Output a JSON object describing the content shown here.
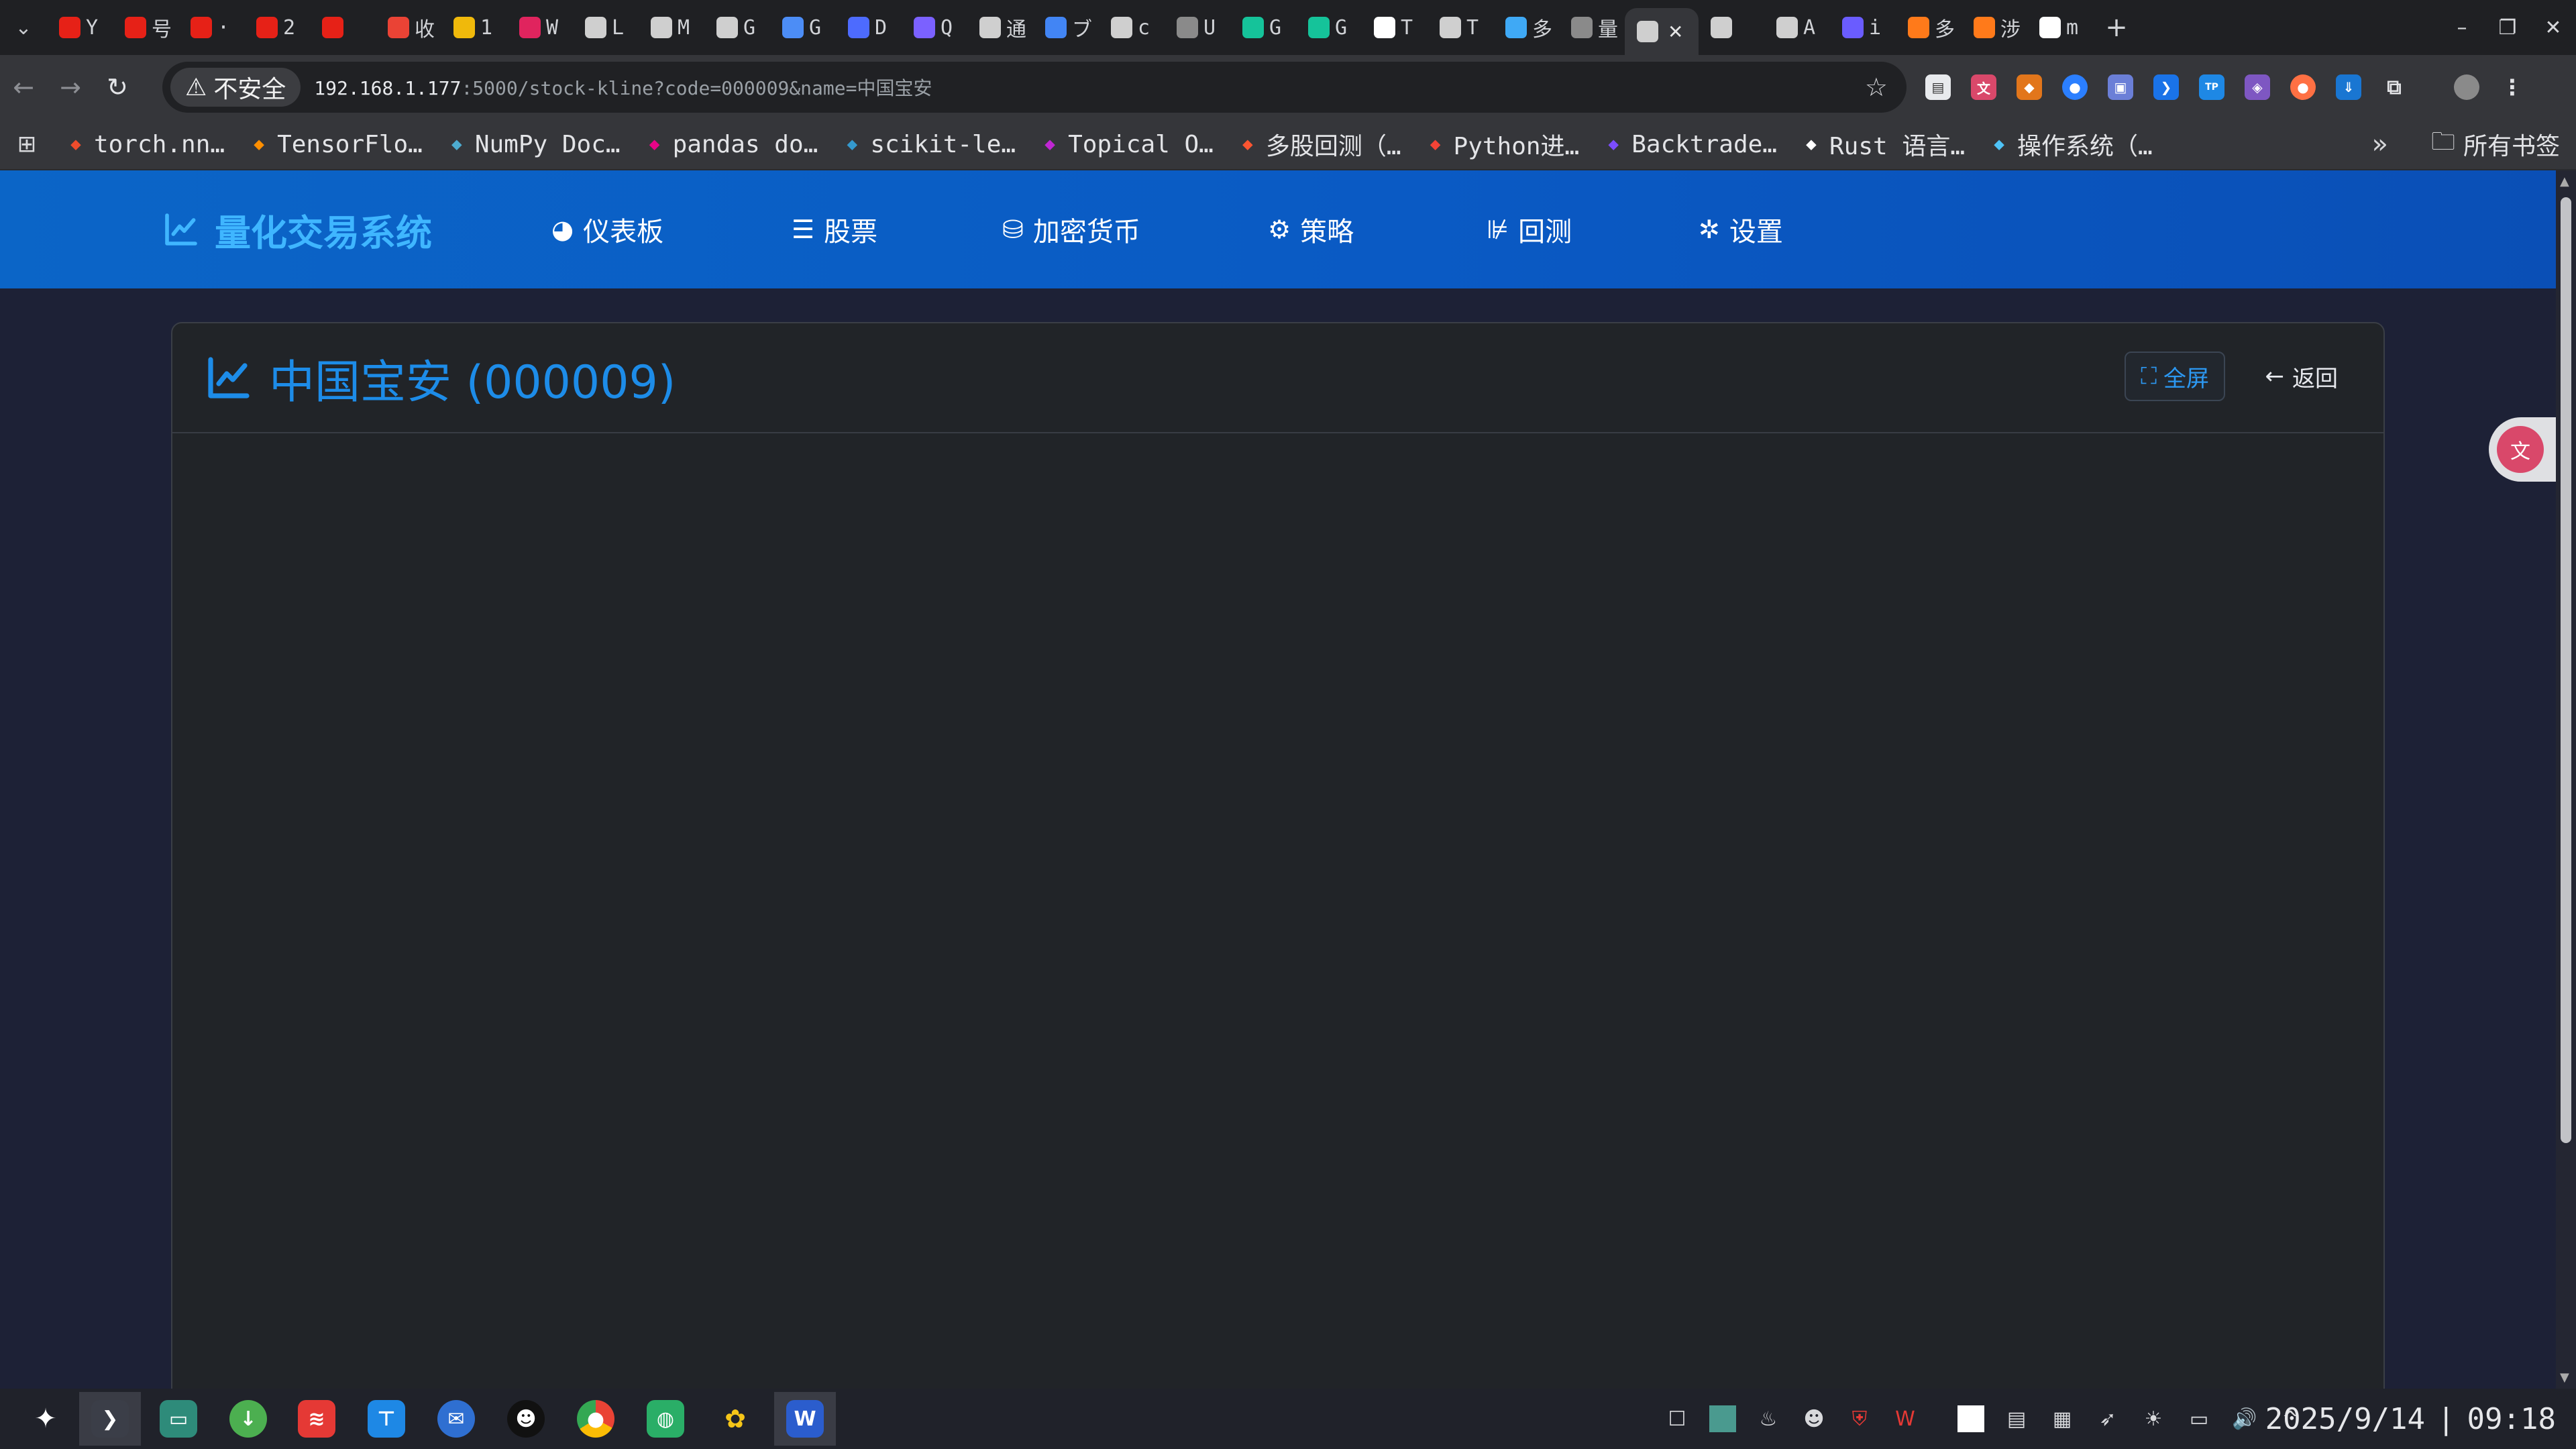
{
  "browser": {
    "tabs": [
      {
        "icon": "youtube-icon",
        "letter": "Y",
        "color": "#e62117"
      },
      {
        "icon": "youtube-icon",
        "letter": "号",
        "color": "#e62117"
      },
      {
        "icon": "youtube-icon",
        "letter": "·",
        "color": "#e62117"
      },
      {
        "icon": "youtube-icon",
        "letter": "2",
        "color": "#e62117"
      },
      {
        "icon": "youtube-icon",
        "letter": "",
        "color": "#e62117"
      },
      {
        "icon": "gmail-icon",
        "letter": "收",
        "color": "#ea4335"
      },
      {
        "icon": "binance-icon",
        "letter": "1",
        "color": "#f0b90b"
      },
      {
        "icon": "graph-icon",
        "letter": "W",
        "color": "#e0245e"
      },
      {
        "icon": "openai-icon",
        "letter": "L",
        "color": "#cfcfcf"
      },
      {
        "icon": "slash-icon",
        "letter": "M",
        "color": "#cfcfcf"
      },
      {
        "icon": "app-icon",
        "letter": "G",
        "color": "#cfcfcf"
      },
      {
        "icon": "gemini-icon",
        "letter": "G",
        "color": "#4c8df6"
      },
      {
        "icon": "deepseek-icon",
        "letter": "D",
        "color": "#4d6bfe"
      },
      {
        "icon": "qwen-icon",
        "letter": "Q",
        "color": "#7b61ff"
      },
      {
        "icon": "grid-icon",
        "letter": "通",
        "color": "#cfcfcf"
      },
      {
        "icon": "doc-icon",
        "letter": "ブ",
        "color": "#4285f4"
      },
      {
        "icon": "terminal-icon",
        "letter": "c",
        "color": "#cfcfcf"
      },
      {
        "icon": "globe-icon",
        "letter": "U",
        "color": "#8a8a8a"
      },
      {
        "icon": "grammarly-icon",
        "letter": "G",
        "color": "#15c39a"
      },
      {
        "icon": "grammarly-icon",
        "letter": "G",
        "color": "#15c39a"
      },
      {
        "icon": "github-icon",
        "letter": "T",
        "color": "#ffffff"
      },
      {
        "icon": "openai-icon",
        "letter": "T",
        "color": "#cfcfcf"
      },
      {
        "icon": "flutter-icon",
        "letter": "多",
        "color": "#3fa9f5"
      },
      {
        "icon": "globe-icon",
        "letter": "量",
        "color": "#8a8a8a"
      },
      {
        "icon": "page-icon",
        "letter": "",
        "color": "#cfcfcf"
      },
      {
        "icon": "book-icon",
        "letter": "A",
        "color": "#cfcfcf"
      },
      {
        "icon": "ai-icon",
        "letter": "i",
        "color": "#6a5cff"
      },
      {
        "icon": "feather-icon",
        "letter": "多",
        "color": "#ff7a1a"
      },
      {
        "icon": "feather-icon",
        "letter": "涉",
        "color": "#ff7a1a"
      },
      {
        "icon": "github-icon",
        "letter": "m",
        "color": "#ffffff"
      }
    ],
    "insecure_label": "不安全",
    "url_host": "192.168.1.177",
    "url_rest": ":5000/stock-kline?code=000009&name=中国宝安",
    "bookmarks": [
      {
        "icon": "pytorch-icon",
        "label": "torch.nn…",
        "color": "#ee4c2c"
      },
      {
        "icon": "tensorflow-icon",
        "label": "TensorFlo…",
        "color": "#ff8f00"
      },
      {
        "icon": "numpy-icon",
        "label": "NumPy Doc…",
        "color": "#4dabcf"
      },
      {
        "icon": "pandas-icon",
        "label": "pandas do…",
        "color": "#e70488"
      },
      {
        "icon": "sklearn-icon",
        "label": "scikit-le…",
        "color": "#3499cd"
      },
      {
        "icon": "topical-icon",
        "label": "Topical O…",
        "color": "#c026d3"
      },
      {
        "icon": "c-icon",
        "label": "多股回测（…",
        "color": "#fc5531"
      },
      {
        "icon": "fire-icon",
        "label": "Python进…",
        "color": "#f44336"
      },
      {
        "icon": "backtrader-icon",
        "label": "Backtrade…",
        "color": "#7c4dff"
      },
      {
        "icon": "rust-icon",
        "label": "Rust 语言…",
        "color": "#ffffff"
      },
      {
        "icon": "calendar-icon",
        "label": "操作系统（…",
        "color": "#4fc3f7"
      }
    ],
    "all_bookmarks": "所有书签"
  },
  "app": {
    "brand": "量化交易系统",
    "nav": [
      {
        "icon": "dashboard-icon",
        "label": "仪表板"
      },
      {
        "icon": "list-icon",
        "label": "股票"
      },
      {
        "icon": "coins-icon",
        "label": "加密货币"
      },
      {
        "icon": "gears-icon",
        "label": "策略"
      },
      {
        "icon": "backtest-icon",
        "label": "回测"
      },
      {
        "icon": "gear-icon",
        "label": "设置"
      }
    ],
    "title": "中国宝安 (000009)",
    "fullscreen_label": "全屏",
    "back_label": "返回"
  },
  "taskbar": {
    "date": "2025/9/14",
    "time": "09:18"
  }
}
